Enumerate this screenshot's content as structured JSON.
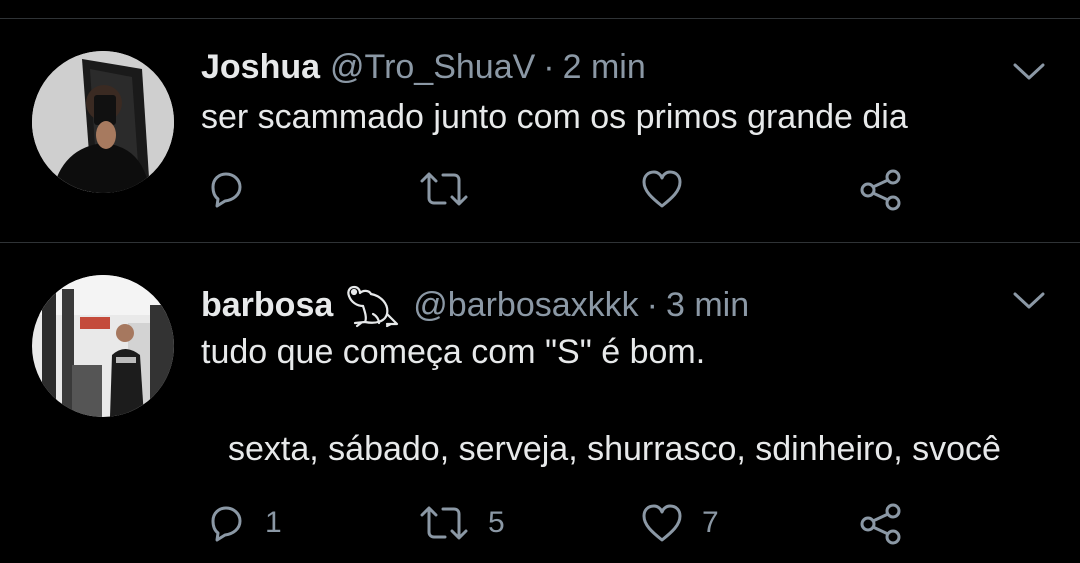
{
  "tweets": [
    {
      "name": "Joshua",
      "handle": "@Tro_ShuaV",
      "separator": "·",
      "time": "2 min",
      "text_lines": [
        "ser scammado junto com os primos grande dia"
      ],
      "actions": {
        "reply": {
          "icon": "reply-icon",
          "count": ""
        },
        "retweet": {
          "icon": "retweet-icon",
          "count": ""
        },
        "like": {
          "icon": "heart-icon",
          "count": ""
        },
        "share": {
          "icon": "share-icon"
        }
      }
    },
    {
      "name": "barbosa",
      "name_emoji": "frog-emoji",
      "handle": "@barbosaxkkk",
      "separator": "·",
      "time": "3 min",
      "text_lines": [
        "tudo que começa com \"S\" é  bom.",
        "sexta, sábado, serveja, shurrasco, sdinheiro, svocê"
      ],
      "actions": {
        "reply": {
          "icon": "reply-icon",
          "count": "1"
        },
        "retweet": {
          "icon": "retweet-icon",
          "count": "5"
        },
        "like": {
          "icon": "heart-icon",
          "count": "7"
        },
        "share": {
          "icon": "share-icon"
        }
      }
    }
  ],
  "colors": {
    "background": "#000000",
    "text_primary": "#e7e9ea",
    "text_secondary": "#8b98a5",
    "divider": "#2f3336"
  }
}
